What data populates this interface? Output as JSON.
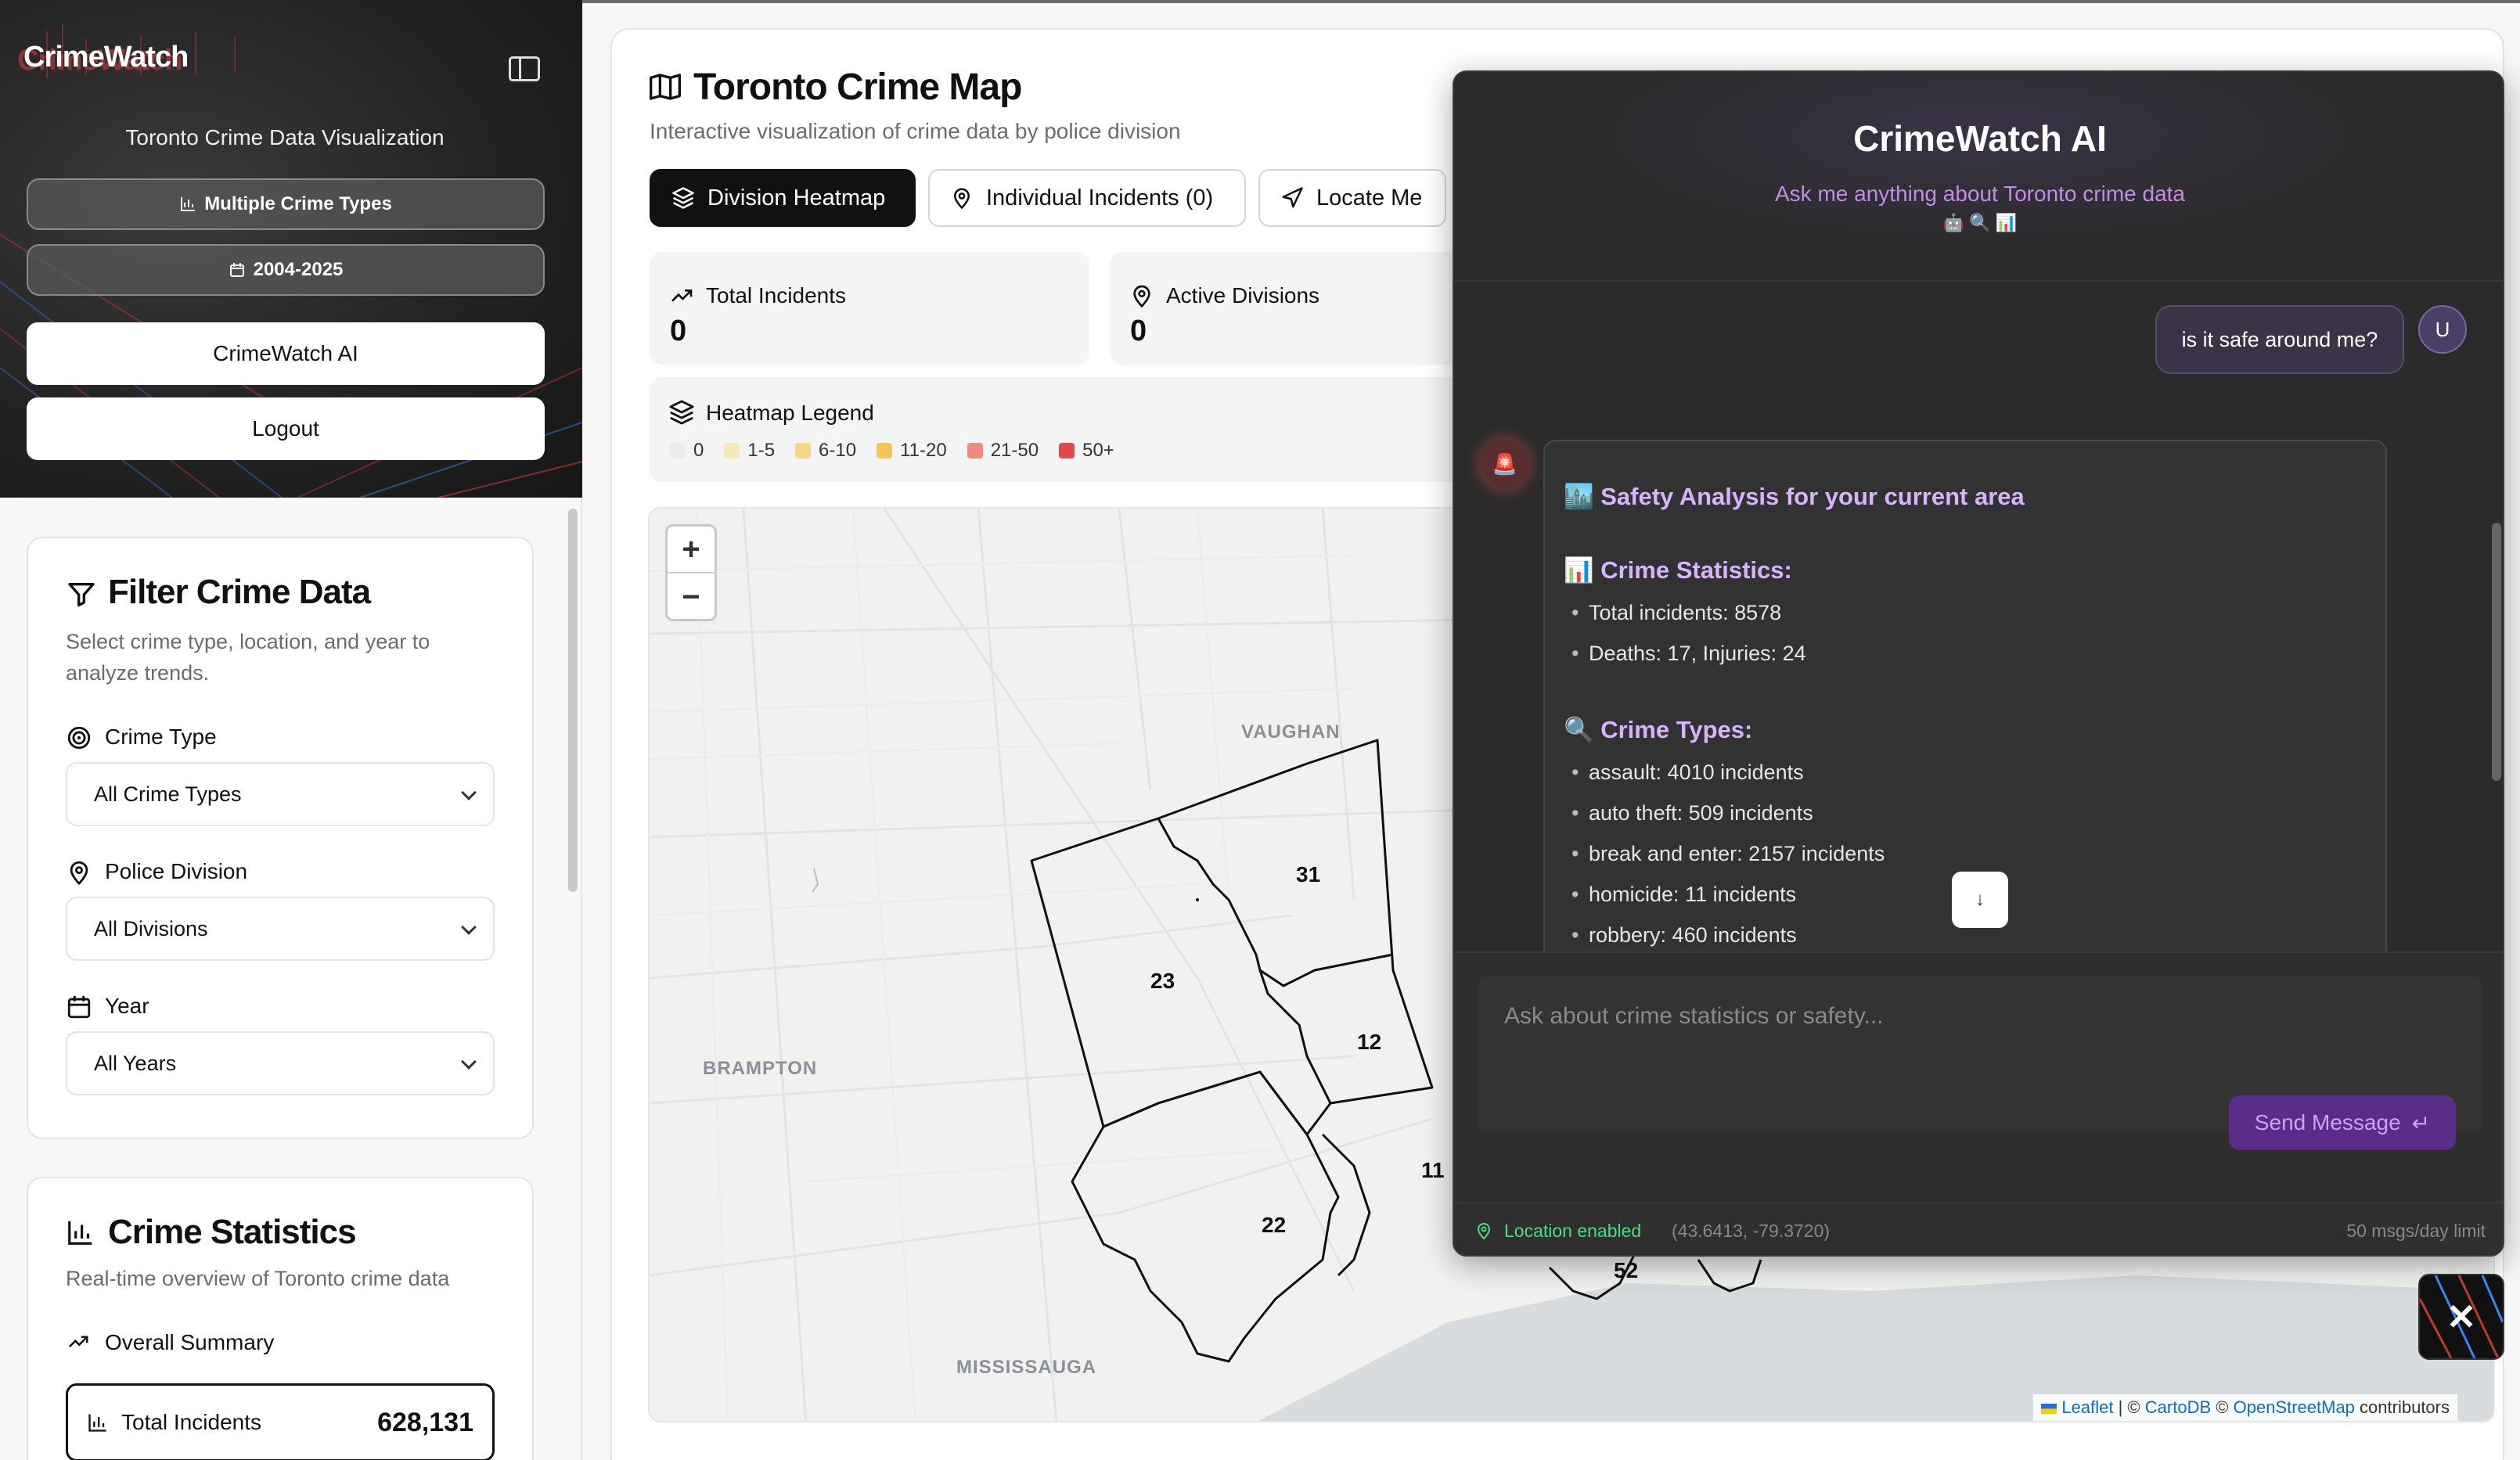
{
  "sidebar": {
    "logo": "CrimeWatch",
    "subtitle": "Toronto Crime Data Visualization",
    "crime_types_pill": "Multiple Crime Types",
    "years_pill": "2004-2025",
    "ai_button": "CrimeWatch AI",
    "logout_button": "Logout"
  },
  "filter": {
    "title": "Filter Crime Data",
    "description": "Select crime type, location, and year to analyze trends.",
    "crime_type_label": "Crime Type",
    "crime_type_value": "All Crime Types",
    "division_label": "Police Division",
    "division_value": "All Divisions",
    "year_label": "Year",
    "year_value": "All Years"
  },
  "stats": {
    "title": "Crime Statistics",
    "description": "Real-time overview of Toronto crime data",
    "summary_label": "Overall Summary",
    "total_label": "Total Incidents",
    "total_value": "628,131"
  },
  "main": {
    "title": "Toronto Crime Map",
    "subtitle": "Interactive visualization of crime data by police division",
    "tabs": [
      {
        "label": "Division Heatmap",
        "active": true
      },
      {
        "label": "Individual Incidents (0)",
        "active": false
      },
      {
        "label": "Locate Me",
        "active": false
      }
    ],
    "total_incidents_label": "Total Incidents",
    "total_incidents_value": "0",
    "active_divisions_label": "Active Divisions",
    "active_divisions_value": "0",
    "legend_title": "Heatmap Legend",
    "legend": [
      {
        "label": "0",
        "color": "#ececec"
      },
      {
        "label": "1-5",
        "color": "#f7e7b4"
      },
      {
        "label": "6-10",
        "color": "#f5d78a"
      },
      {
        "label": "11-20",
        "color": "#f3c55a"
      },
      {
        "label": "21-50",
        "color": "#ee8a7a"
      },
      {
        "label": "50+",
        "color": "#e04a4a"
      }
    ]
  },
  "map": {
    "zoom_in": "+",
    "zoom_out": "−",
    "places": [
      "VAUGHAN",
      "BRAMPTON",
      "MISSISSAUGA"
    ],
    "divisions": [
      "31",
      "23",
      "12",
      "11",
      "22",
      "52"
    ],
    "attribution_leaflet": "Leaflet",
    "attribution_sep1": "| ©",
    "attribution_cartodb": "CartoDB",
    "attribution_sep2": "©",
    "attribution_osm": "OpenStreetMap",
    "attribution_tail": "contributors"
  },
  "chat": {
    "title": "CrimeWatch AI",
    "subtitle": "Ask me anything about Toronto crime data",
    "emojis": "🤖 🔍 📊",
    "user_message": "is it safe around me?",
    "user_avatar": "U",
    "bot_avatar": "🚨",
    "analysis_heading": "🏙️ Safety Analysis for your current area",
    "stats_heading": "📊 Crime Statistics:",
    "stats_lines": [
      "Total incidents: 8578",
      "Deaths: 17, Injuries: 24"
    ],
    "types_heading": "🔍 Crime Types:",
    "types_lines": [
      "assault: 4010 incidents",
      "auto theft: 509 incidents",
      "break and enter: 2157 incidents",
      "homicide: 11 incidents",
      "robbery: 460 incidents"
    ],
    "scroll_down": "↓",
    "input_placeholder": "Ask about crime statistics or safety...",
    "send_label": "Send Message",
    "send_icon": "↵",
    "location_status": "Location enabled",
    "location_coords": "(43.6413, -79.3720)",
    "limit_text": "50 msgs/day limit",
    "close": "✕"
  },
  "colors": {
    "accent_purple": "#d8b4fe",
    "send_button": "#5b2c8a",
    "location_green": "#4ade80",
    "dark_panel": "#2b2b2b"
  }
}
